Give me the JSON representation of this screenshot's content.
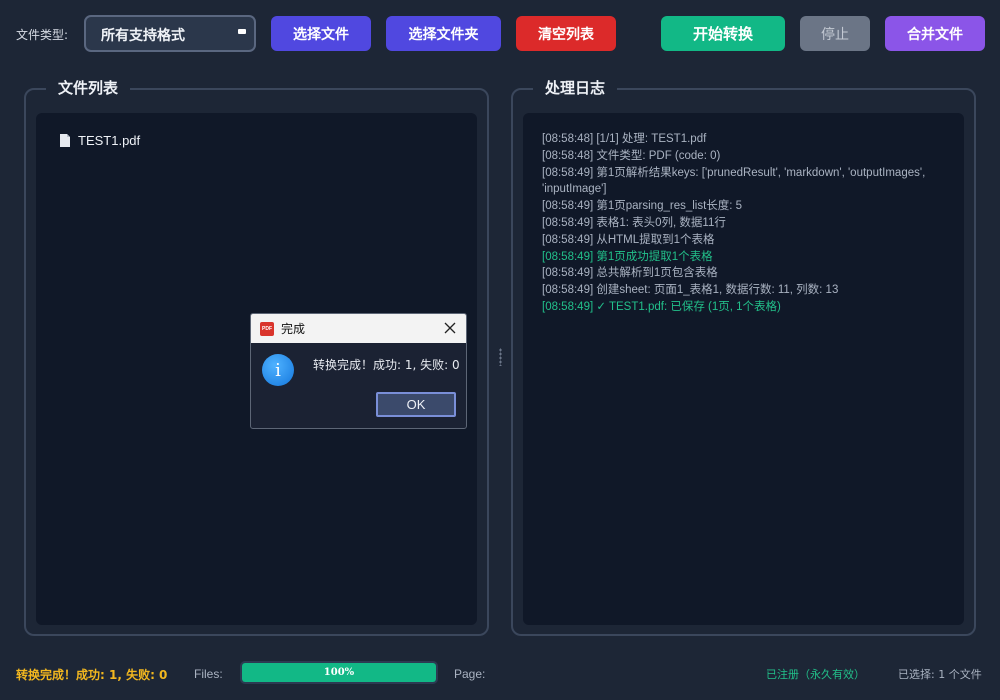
{
  "toolbar": {
    "file_type_label": "文件类型:",
    "file_type_selected": "所有支持格式",
    "select_file_label": "选择文件",
    "select_folder_label": "选择文件夹",
    "clear_list_label": "清空列表",
    "start_convert_label": "开始转换",
    "stop_label": "停止",
    "merge_files_label": "合并文件"
  },
  "file_panel": {
    "title": "文件列表",
    "files": [
      "TEST1.pdf"
    ]
  },
  "log_panel": {
    "title": "处理日志",
    "lines": [
      {
        "text": "[08:58:48] [1/1] 处理: TEST1.pdf",
        "status": "normal"
      },
      {
        "text": "[08:58:48] 文件类型: PDF (code: 0)",
        "status": "normal"
      },
      {
        "text": "[08:58:49] 第1页解析结果keys: ['prunedResult', 'markdown', 'outputImages', 'inputImage']",
        "status": "normal"
      },
      {
        "text": "[08:58:49] 第1页parsing_res_list长度: 5",
        "status": "normal"
      },
      {
        "text": "[08:58:49] 表格1: 表头0列, 数据11行",
        "status": "normal"
      },
      {
        "text": "[08:58:49] 从HTML提取到1个表格",
        "status": "normal"
      },
      {
        "text": "[08:58:49] 第1页成功提取1个表格",
        "status": "success"
      },
      {
        "text": "[08:58:49] 总共解析到1页包含表格",
        "status": "normal"
      },
      {
        "text": "[08:58:49] 创建sheet: 页面1_表格1, 数据行数: 11, 列数: 13",
        "status": "normal"
      },
      {
        "text": "[08:58:49] ✓ TEST1.pdf: 已保存 (1页, 1个表格)",
        "status": "success"
      }
    ]
  },
  "dialog": {
    "icon_text": "PDF",
    "title": "完成",
    "message": "转换完成！成功: 1, 失败: 0",
    "ok_label": "OK"
  },
  "status_bar": {
    "message": "转换完成！成功: 1, 失败: 0",
    "files_label": "Files:",
    "progress_percent": 100,
    "progress_text": "100%",
    "page_label": "Page:",
    "registration": "已注册（永久有效）",
    "selected_count": "已选择: 1 个文件"
  },
  "colors": {
    "primary": "#5048e0",
    "danger": "#dc2a2a",
    "success": "#12b886",
    "merge": "#8b55e8",
    "warning_text": "#f2b71f"
  }
}
